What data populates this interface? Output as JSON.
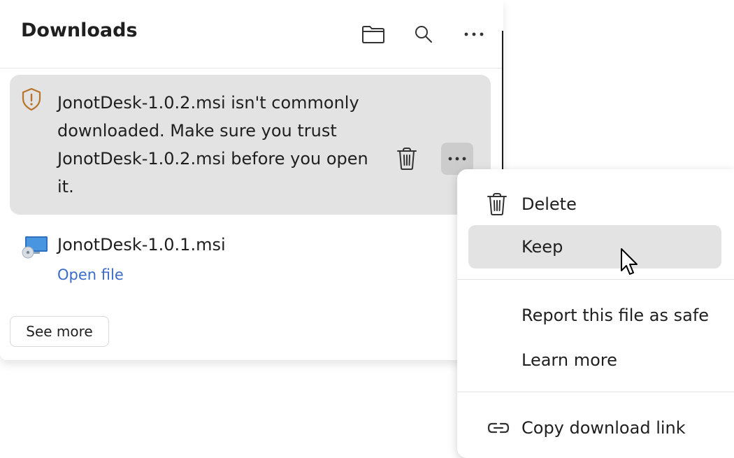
{
  "panel": {
    "title": "Downloads",
    "header_icons": [
      "folder-icon",
      "search-icon",
      "more-horizontal-icon"
    ]
  },
  "warning_item": {
    "message": "JonotDesk-1.0.2.msi isn't commonly downloaded. Make sure you trust JonotDesk-1.0.2.msi before you open it.",
    "icon": "shield-warning-icon"
  },
  "completed_item": {
    "filename": "JonotDesk-1.0.1.msi",
    "action_label": "Open file",
    "icon": "installer-file-icon"
  },
  "see_more_label": "See more",
  "context_menu": {
    "items": [
      {
        "label": "Delete",
        "icon": "trash-icon"
      },
      {
        "label": "Keep"
      },
      {
        "label": "Report this file as safe"
      },
      {
        "label": "Learn more"
      },
      {
        "label": "Copy download link",
        "icon": "link-icon"
      }
    ],
    "hovered": "Keep"
  },
  "colors": {
    "link": "#3b6cc9",
    "card_bg": "#e3e3e3",
    "warning_icon": "#b8742a"
  }
}
